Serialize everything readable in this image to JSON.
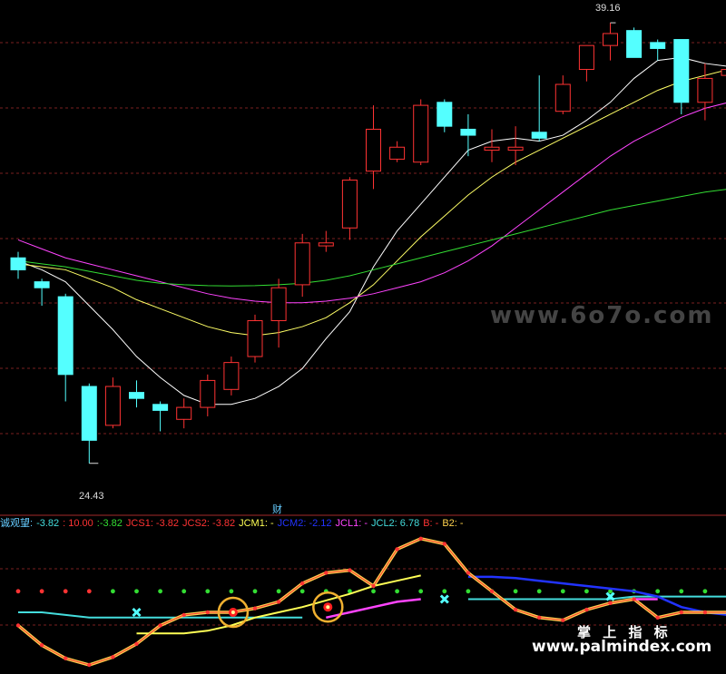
{
  "chart_data": [
    {
      "type": "candlestick",
      "title": "",
      "annotations": {
        "high_label": "39.16",
        "low_label": "24.43"
      },
      "ylim": [
        23.3,
        39.8
      ],
      "candles": [
        {
          "o": 31.3,
          "h": 31.5,
          "l": 30.6,
          "c": 30.9
        },
        {
          "o": 30.5,
          "h": 30.6,
          "l": 29.7,
          "c": 30.3
        },
        {
          "o": 30.0,
          "h": 30.1,
          "l": 26.5,
          "c": 27.4
        },
        {
          "o": 27.0,
          "h": 27.1,
          "l": 24.43,
          "c": 25.2
        },
        {
          "o": 25.7,
          "h": 27.3,
          "l": 25.6,
          "c": 27.0
        },
        {
          "o": 26.8,
          "h": 27.2,
          "l": 26.3,
          "c": 26.6
        },
        {
          "o": 26.4,
          "h": 26.5,
          "l": 25.5,
          "c": 26.2
        },
        {
          "o": 25.9,
          "h": 26.6,
          "l": 25.6,
          "c": 26.3
        },
        {
          "o": 26.3,
          "h": 27.4,
          "l": 26.0,
          "c": 27.2
        },
        {
          "o": 26.9,
          "h": 28.0,
          "l": 26.7,
          "c": 27.8
        },
        {
          "o": 28.0,
          "h": 29.4,
          "l": 27.8,
          "c": 29.2
        },
        {
          "o": 29.2,
          "h": 30.6,
          "l": 28.3,
          "c": 30.3
        },
        {
          "o": 30.4,
          "h": 32.1,
          "l": 30.0,
          "c": 31.8
        },
        {
          "o": 31.7,
          "h": 32.2,
          "l": 31.5,
          "c": 31.8
        },
        {
          "o": 32.3,
          "h": 34.0,
          "l": 31.9,
          "c": 33.9
        },
        {
          "o": 34.2,
          "h": 36.4,
          "l": 33.6,
          "c": 35.6
        },
        {
          "o": 34.6,
          "h": 35.2,
          "l": 34.5,
          "c": 35.0
        },
        {
          "o": 34.5,
          "h": 36.6,
          "l": 34.4,
          "c": 36.4
        },
        {
          "o": 36.5,
          "h": 36.6,
          "l": 35.5,
          "c": 35.7
        },
        {
          "o": 35.6,
          "h": 36.1,
          "l": 34.7,
          "c": 35.4
        },
        {
          "o": 34.9,
          "h": 35.6,
          "l": 34.5,
          "c": 35.0
        },
        {
          "o": 34.9,
          "h": 35.7,
          "l": 34.4,
          "c": 35.0
        },
        {
          "o": 35.5,
          "h": 37.4,
          "l": 35.2,
          "c": 35.3
        },
        {
          "o": 36.2,
          "h": 37.4,
          "l": 36.1,
          "c": 37.1
        },
        {
          "o": 37.6,
          "h": 38.4,
          "l": 37.2,
          "c": 38.4
        },
        {
          "o": 38.4,
          "h": 39.16,
          "l": 37.9,
          "c": 38.8
        },
        {
          "o": 38.9,
          "h": 39.0,
          "l": 38.0,
          "c": 38.0
        },
        {
          "o": 38.5,
          "h": 38.6,
          "l": 37.9,
          "c": 38.3
        },
        {
          "o": 38.6,
          "h": 38.6,
          "l": 36.1,
          "c": 36.5
        },
        {
          "o": 36.5,
          "h": 37.8,
          "l": 35.9,
          "c": 37.3
        },
        {
          "o": 37.4,
          "h": 38.0,
          "l": 37.0,
          "c": 37.6
        }
      ],
      "ma": [
        {
          "color": "#ffffff",
          "values": [
            31.2,
            30.9,
            30.5,
            29.7,
            28.9,
            28.0,
            27.3,
            26.7,
            26.4,
            26.4,
            26.6,
            27.0,
            27.6,
            28.6,
            29.5,
            31.0,
            32.2,
            33.1,
            34.0,
            34.9,
            35.2,
            35.3,
            35.2,
            35.4,
            35.9,
            36.5,
            37.3,
            37.9,
            38.0,
            37.8,
            37.7
          ]
        },
        {
          "color": "#ffff66",
          "values": [
            31.1,
            31.0,
            30.9,
            30.6,
            30.3,
            29.9,
            29.6,
            29.3,
            29.0,
            28.8,
            28.7,
            28.8,
            29.0,
            29.3,
            29.8,
            30.4,
            31.2,
            32.0,
            32.7,
            33.4,
            34.0,
            34.5,
            34.9,
            35.3,
            35.7,
            36.1,
            36.5,
            36.9,
            37.2,
            37.4,
            37.6
          ]
        },
        {
          "color": "#ff44ff",
          "values": [
            31.9,
            31.6,
            31.3,
            31.1,
            30.9,
            30.7,
            30.5,
            30.3,
            30.1,
            29.95,
            29.85,
            29.8,
            29.8,
            29.85,
            29.95,
            30.1,
            30.3,
            30.5,
            30.8,
            31.2,
            31.7,
            32.3,
            32.9,
            33.5,
            34.1,
            34.7,
            35.2,
            35.6,
            36.0,
            36.3,
            36.5
          ]
        },
        {
          "color": "#33dd33",
          "values": [
            31.2,
            31.1,
            31.0,
            30.85,
            30.7,
            30.55,
            30.45,
            30.4,
            30.37,
            30.36,
            30.37,
            30.4,
            30.45,
            30.55,
            30.7,
            30.9,
            31.1,
            31.3,
            31.5,
            31.7,
            31.9,
            32.1,
            32.3,
            32.5,
            32.7,
            32.9,
            33.05,
            33.2,
            33.35,
            33.5,
            33.6
          ]
        }
      ]
    },
    {
      "type": "line",
      "title": "",
      "ylim": [
        0,
        100
      ],
      "series": [
        {
          "name": "JCS1",
          "color": "#ff3333",
          "values": [
            30,
            15,
            5,
            0,
            6,
            16,
            30,
            38,
            40,
            40,
            43,
            48,
            62,
            70,
            72,
            60,
            88,
            96,
            92,
            70,
            56,
            42,
            36,
            34,
            42,
            47,
            50,
            36,
            40,
            40,
            40
          ]
        },
        {
          "name": "JCS2",
          "color": "#ffd24d",
          "values": [
            30,
            15,
            5,
            0,
            6,
            16,
            30,
            38,
            40,
            40,
            43,
            48,
            62,
            70,
            72,
            60,
            88,
            96,
            92,
            70,
            56,
            42,
            36,
            34,
            42,
            47,
            50,
            36,
            40,
            40,
            40
          ]
        },
        {
          "name": "JCM1",
          "color": "#ffff55",
          "values": [
            null,
            null,
            null,
            null,
            null,
            24,
            24,
            24,
            26,
            30,
            36,
            40,
            44,
            49,
            54,
            60,
            64,
            68,
            null,
            null,
            null,
            null,
            null,
            null,
            null,
            null,
            null,
            null,
            null,
            null,
            null
          ]
        },
        {
          "name": "JCM2",
          "color": "#2233ff",
          "values": [
            null,
            null,
            null,
            null,
            null,
            null,
            null,
            null,
            null,
            null,
            null,
            null,
            null,
            null,
            null,
            null,
            null,
            null,
            null,
            67,
            67,
            66,
            64,
            62,
            60,
            58,
            56,
            52,
            44,
            40,
            38
          ]
        },
        {
          "name": "JCL1",
          "color": "#ff44ff",
          "values": [
            null,
            null,
            null,
            null,
            null,
            null,
            null,
            null,
            null,
            null,
            null,
            null,
            null,
            36,
            40,
            44,
            48,
            50,
            null,
            null,
            null,
            null,
            null,
            null,
            null,
            null,
            50,
            50,
            null,
            null,
            null
          ]
        },
        {
          "name": "JCL2",
          "color": "#44dddd",
          "values": [
            40,
            40,
            38,
            36,
            36,
            36,
            36,
            36,
            36,
            36,
            36,
            36,
            36,
            null,
            null,
            null,
            null,
            null,
            null,
            50,
            50,
            50,
            50,
            50,
            50,
            50,
            52,
            52,
            52,
            52,
            52
          ]
        }
      ],
      "dot_levels": [
        {
          "level": 56,
          "pattern": [
            "#ff3333",
            "#ff3333",
            "#ff3333",
            "#ff3333",
            "#33dd33",
            "#33dd33",
            "#33dd33",
            "#33dd33",
            "#33dd33",
            "#33dd33",
            "#33dd33",
            "#33dd33",
            "#33dd33",
            "#33dd33",
            "#33dd33",
            "#33dd33",
            "#33dd33",
            "#33dd33",
            "#33dd33",
            "#33dd33",
            "#33dd33",
            "#33dd33",
            "#33dd33",
            "#33dd33",
            "#33dd33",
            "#33dd33",
            "#33dd33",
            "#33dd33",
            "#33dd33",
            "#33dd33",
            "#33dd33"
          ]
        }
      ]
    }
  ],
  "legend": {
    "prefix": "诚观望:",
    "items": [
      {
        "label": "-3.82",
        "color": "#44dddd"
      },
      {
        "label": ": 10.00",
        "color": "#ff3333"
      },
      {
        "label": ":-3.82",
        "color": "#33dd33"
      },
      {
        "label": "JCS1: -3.82",
        "color": "#ff3333"
      },
      {
        "label": "JCS2: -3.82",
        "color": "#ff3333"
      },
      {
        "label": "JCM1: -",
        "color": "#ffff55"
      },
      {
        "label": "JCM2: -2.12",
        "color": "#2233ff"
      },
      {
        "label": "JCL1: -",
        "color": "#ff44ff"
      },
      {
        "label": "JCL2: 6.78",
        "color": "#44dddd"
      },
      {
        "label": "B: -",
        "color": "#ff3333"
      },
      {
        "label": "B2: -",
        "color": "#ffd24d"
      }
    ]
  },
  "sub_label": "财",
  "watermark": {
    "main": "www.6o7o.com",
    "cn": "掌 上 指 标",
    "site": "www.palmindex.com"
  },
  "colors": {
    "up": "#ff3333",
    "down": "#54ffff",
    "bg": "#000000",
    "grid": "#7a1f1f"
  }
}
